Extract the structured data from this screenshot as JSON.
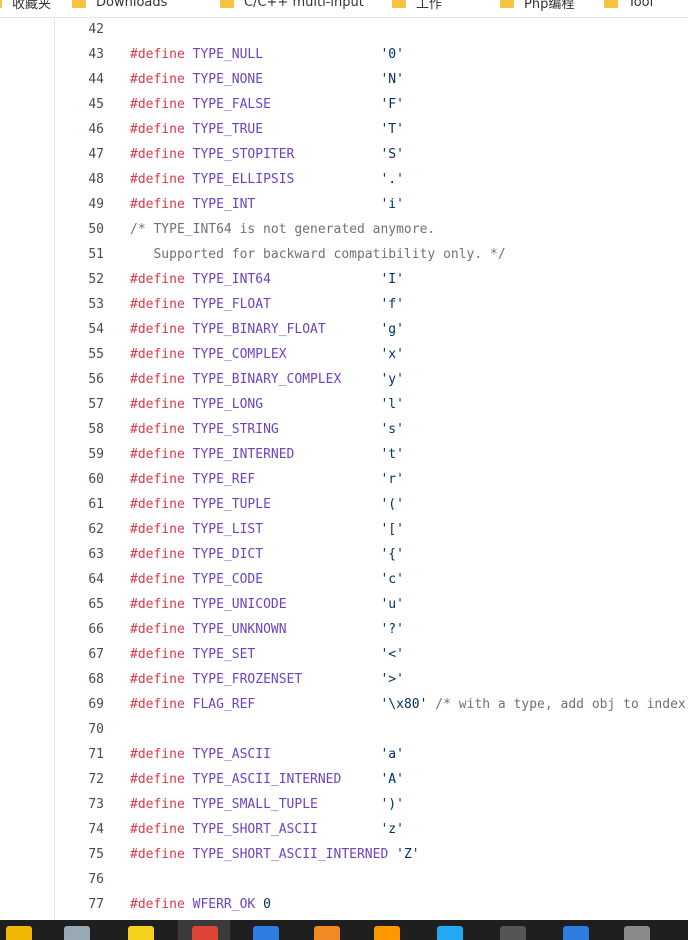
{
  "bookmarks": [
    {
      "label": "收藏夹",
      "icon": "folder-icon"
    },
    {
      "label": "Downloads",
      "icon": "folder-icon"
    },
    {
      "label": "C/C++ multi-input",
      "icon": "folder-icon"
    },
    {
      "label": "工作",
      "icon": "folder-icon"
    },
    {
      "label": "Php编程",
      "icon": "folder-icon"
    },
    {
      "label": "Tool",
      "icon": "folder-icon"
    }
  ],
  "code": {
    "lines": [
      {
        "n": "42",
        "type": "blank"
      },
      {
        "n": "43",
        "type": "define",
        "kw": "#define",
        "name": "TYPE_NULL",
        "pad": "               ",
        "value": "'0'"
      },
      {
        "n": "44",
        "type": "define",
        "kw": "#define",
        "name": "TYPE_NONE",
        "pad": "               ",
        "value": "'N'"
      },
      {
        "n": "45",
        "type": "define",
        "kw": "#define",
        "name": "TYPE_FALSE",
        "pad": "              ",
        "value": "'F'"
      },
      {
        "n": "46",
        "type": "define",
        "kw": "#define",
        "name": "TYPE_TRUE",
        "pad": "               ",
        "value": "'T'"
      },
      {
        "n": "47",
        "type": "define",
        "kw": "#define",
        "name": "TYPE_STOPITER",
        "pad": "           ",
        "value": "'S'"
      },
      {
        "n": "48",
        "type": "define",
        "kw": "#define",
        "name": "TYPE_ELLIPSIS",
        "pad": "           ",
        "value": "'.'"
      },
      {
        "n": "49",
        "type": "define",
        "kw": "#define",
        "name": "TYPE_INT",
        "pad": "                ",
        "value": "'i'"
      },
      {
        "n": "50",
        "type": "comment",
        "text": "/* TYPE_INT64 is not generated anymore."
      },
      {
        "n": "51",
        "type": "comment",
        "text": "   Supported for backward compatibility only. */"
      },
      {
        "n": "52",
        "type": "define",
        "kw": "#define",
        "name": "TYPE_INT64",
        "pad": "              ",
        "value": "'I'"
      },
      {
        "n": "53",
        "type": "define",
        "kw": "#define",
        "name": "TYPE_FLOAT",
        "pad": "              ",
        "value": "'f'"
      },
      {
        "n": "54",
        "type": "define",
        "kw": "#define",
        "name": "TYPE_BINARY_FLOAT",
        "pad": "       ",
        "value": "'g'"
      },
      {
        "n": "55",
        "type": "define",
        "kw": "#define",
        "name": "TYPE_COMPLEX",
        "pad": "            ",
        "value": "'x'"
      },
      {
        "n": "56",
        "type": "define",
        "kw": "#define",
        "name": "TYPE_BINARY_COMPLEX",
        "pad": "     ",
        "value": "'y'"
      },
      {
        "n": "57",
        "type": "define",
        "kw": "#define",
        "name": "TYPE_LONG",
        "pad": "               ",
        "value": "'l'"
      },
      {
        "n": "58",
        "type": "define",
        "kw": "#define",
        "name": "TYPE_STRING",
        "pad": "             ",
        "value": "'s'"
      },
      {
        "n": "59",
        "type": "define",
        "kw": "#define",
        "name": "TYPE_INTERNED",
        "pad": "           ",
        "value": "'t'"
      },
      {
        "n": "60",
        "type": "define",
        "kw": "#define",
        "name": "TYPE_REF",
        "pad": "                ",
        "value": "'r'"
      },
      {
        "n": "61",
        "type": "define",
        "kw": "#define",
        "name": "TYPE_TUPLE",
        "pad": "              ",
        "value": "'('"
      },
      {
        "n": "62",
        "type": "define",
        "kw": "#define",
        "name": "TYPE_LIST",
        "pad": "               ",
        "value": "'['"
      },
      {
        "n": "63",
        "type": "define",
        "kw": "#define",
        "name": "TYPE_DICT",
        "pad": "               ",
        "value": "'{'"
      },
      {
        "n": "64",
        "type": "define",
        "kw": "#define",
        "name": "TYPE_CODE",
        "pad": "               ",
        "value": "'c'"
      },
      {
        "n": "65",
        "type": "define",
        "kw": "#define",
        "name": "TYPE_UNICODE",
        "pad": "            ",
        "value": "'u'"
      },
      {
        "n": "66",
        "type": "define",
        "kw": "#define",
        "name": "TYPE_UNKNOWN",
        "pad": "            ",
        "value": "'?'"
      },
      {
        "n": "67",
        "type": "define",
        "kw": "#define",
        "name": "TYPE_SET",
        "pad": "                ",
        "value": "'<'"
      },
      {
        "n": "68",
        "type": "define",
        "kw": "#define",
        "name": "TYPE_FROZENSET",
        "pad": "          ",
        "value": "'>'"
      },
      {
        "n": "69",
        "type": "define",
        "kw": "#define",
        "name": "FLAG_REF",
        "pad": "                ",
        "value": "'\\x80'",
        "comment": " /* with a type, add obj to index */"
      },
      {
        "n": "70",
        "type": "blank"
      },
      {
        "n": "71",
        "type": "define",
        "kw": "#define",
        "name": "TYPE_ASCII",
        "pad": "              ",
        "value": "'a'"
      },
      {
        "n": "72",
        "type": "define",
        "kw": "#define",
        "name": "TYPE_ASCII_INTERNED",
        "pad": "     ",
        "value": "'A'"
      },
      {
        "n": "73",
        "type": "define",
        "kw": "#define",
        "name": "TYPE_SMALL_TUPLE",
        "pad": "        ",
        "value": "')'"
      },
      {
        "n": "74",
        "type": "define",
        "kw": "#define",
        "name": "TYPE_SHORT_ASCII",
        "pad": "        ",
        "value": "'z'"
      },
      {
        "n": "75",
        "type": "define",
        "kw": "#define",
        "name": "TYPE_SHORT_ASCII_INTERNED",
        "pad": " ",
        "value": "'Z'"
      },
      {
        "n": "76",
        "type": "blank"
      },
      {
        "n": "77",
        "type": "define",
        "kw": "#define",
        "name": "WFERR_OK",
        "pad": " ",
        "value": "0"
      }
    ]
  },
  "taskbar": {
    "items": [
      {
        "icon": "file-explorer-icon",
        "color": "#f2b705"
      },
      {
        "icon": "notepad-icon",
        "color": "#9aa7b5"
      },
      {
        "icon": "media-player-icon",
        "color": "#f7d21d"
      },
      {
        "icon": "chrome-icon",
        "color": "#db4437"
      },
      {
        "icon": "app-blue-icon",
        "color": "#2f7de1"
      },
      {
        "icon": "app-orange-icon",
        "color": "#f08a24"
      },
      {
        "icon": "sublime-icon",
        "color": "#ff9800"
      },
      {
        "icon": "vscode-icon",
        "color": "#23a8f2"
      },
      {
        "icon": "terminal-icon",
        "color": "#555555"
      },
      {
        "icon": "app-blue2-icon",
        "color": "#2f7de1"
      },
      {
        "icon": "avatar-icon",
        "color": "#8a8a8a"
      }
    ]
  }
}
